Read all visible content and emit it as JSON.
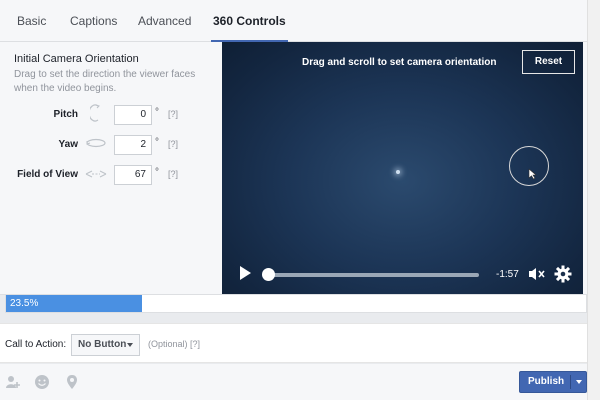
{
  "tabs": [
    {
      "label": "Basic",
      "active": false
    },
    {
      "label": "Captions",
      "active": false
    },
    {
      "label": "Advanced",
      "active": false
    },
    {
      "label": "360 Controls",
      "active": true
    }
  ],
  "orientation": {
    "title": "Initial Camera Orientation",
    "description": "Drag to set the direction the viewer faces when the video begins.",
    "fields": [
      {
        "label": "Pitch",
        "value": "0",
        "unit": "°",
        "help": "[?]",
        "icon": "pitch-icon"
      },
      {
        "label": "Yaw",
        "value": "2",
        "unit": "°",
        "help": "[?]",
        "icon": "yaw-icon"
      },
      {
        "label": "Field of View",
        "value": "67",
        "unit": "°",
        "help": "[?]",
        "icon": "fov-icon"
      }
    ]
  },
  "video": {
    "hint": "Drag and scroll to set camera orientation",
    "reset_label": "Reset",
    "time_remaining": "-1:57",
    "playback_progress": 0.0,
    "icons": [
      "play-icon",
      "volume-muted-icon",
      "gear-icon",
      "cursor-icon"
    ]
  },
  "upload": {
    "percent": 23.5,
    "label": "23.5%",
    "color": "#4a90e2"
  },
  "cta": {
    "label": "Call to Action:",
    "selected": "No Button",
    "optional": "(Optional)",
    "help": "[?]"
  },
  "footer": {
    "icons": [
      "tag-people-icon",
      "feeling-icon",
      "location-icon"
    ],
    "publish_label": "Publish",
    "accent": "#4267b2"
  }
}
